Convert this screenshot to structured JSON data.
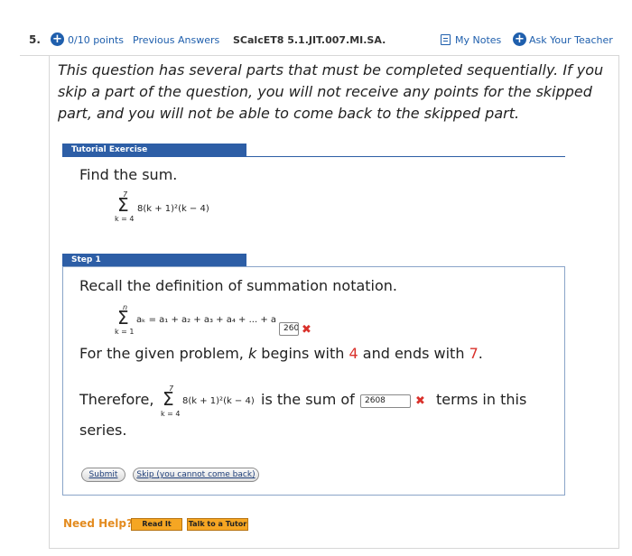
{
  "header": {
    "question_number": "5.",
    "points": "0/10 points",
    "previous_answers": "Previous Answers",
    "assignment_code": "SCalcET8 5.1.JIT.007.MI.SA.",
    "my_notes": "My Notes",
    "ask_teacher": "Ask Your Teacher"
  },
  "intro": "This question has several parts that must be completed sequentially. If you skip a part of the question, you will not receive any points for the skipped part, and you will not be able to come back to the skipped part.",
  "tutorial": {
    "tab_label": "Tutorial Exercise",
    "prompt": "Find the sum.",
    "sum_upper": "7",
    "sum_lower": "k = 4",
    "sum_expr": "8(k + 1)²(k − 4)"
  },
  "step1": {
    "tab_label": "Step 1",
    "text": "Recall the definition of summation notation.",
    "def_upper": "n",
    "def_lower": "k = 1",
    "def_expr": "aₖ = a₁ + a₂ + a₃ + a₄ + ... + a",
    "answer1": "260",
    "given_prefix": "For the given problem, ",
    "given_k": "k",
    "given_mid": " begins with ",
    "given_start": "4",
    "given_and": " and ends with ",
    "given_end": "7",
    "given_period": ".",
    "therefore": "Therefore,",
    "sum_upper": "7",
    "sum_lower": "k = 4",
    "sum_expr": "8(k + 1)²(k − 4)",
    "is_sum_of": "is the sum of",
    "answer2": "2608",
    "terms_text": "terms in this",
    "series_text": "series.",
    "submit": "Submit",
    "skip": "Skip (you cannot come back)"
  },
  "help": {
    "need_help": "Need Help?",
    "read_it": "Read It",
    "talk_tutor": "Talk to a Tutor"
  },
  "colors": {
    "accent_blue": "#1f5fad",
    "tab_blue": "#2d5ea6",
    "error_red": "#d9312b",
    "help_orange": "#e38b1f"
  }
}
